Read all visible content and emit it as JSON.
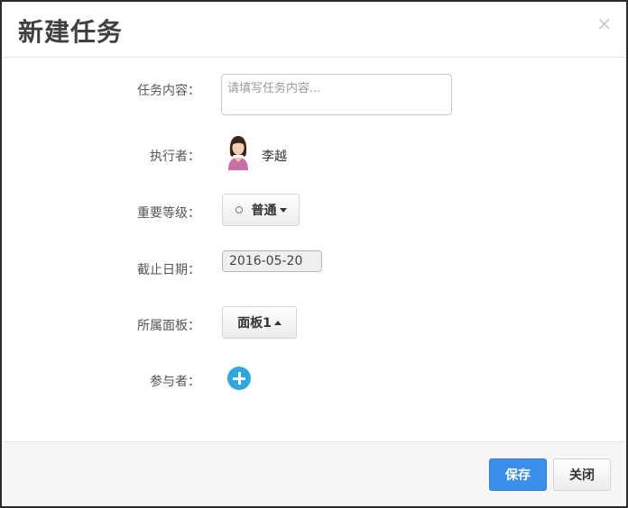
{
  "dialog": {
    "title": "新建任务",
    "close_icon": "×"
  },
  "form": {
    "content": {
      "label": "任务内容：",
      "value": "",
      "placeholder": "请填写任务内容..."
    },
    "assignee": {
      "label": "执行者：",
      "name": "李越",
      "avatar_icon": "user-avatar-female"
    },
    "priority": {
      "label": "重要等级：",
      "value": "普通"
    },
    "due_date": {
      "label": "截止日期：",
      "value": "2016-05-20"
    },
    "panel": {
      "label": "所属面板：",
      "value": "面板1"
    },
    "participants": {
      "label": "参与者：",
      "add_icon": "plus-circle-icon"
    }
  },
  "footer": {
    "save_label": "保存",
    "close_label": "关闭"
  },
  "colors": {
    "primary": "#3b8fe8",
    "add_icon": "#2fa6de"
  }
}
